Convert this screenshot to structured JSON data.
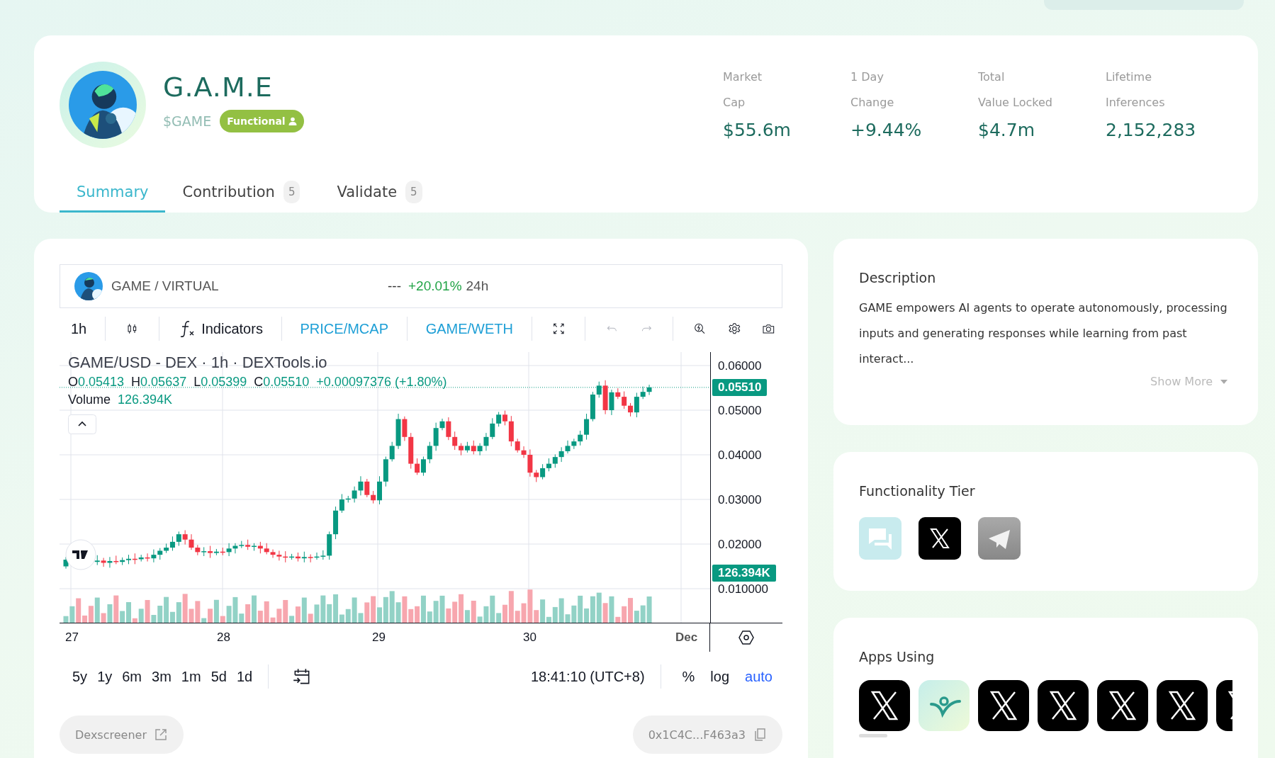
{
  "header": {
    "name": "G.A.M.E",
    "ticker": "$GAME",
    "badge": "Functional",
    "stats": [
      {
        "label": "Market\nCap",
        "value": "$55.6m"
      },
      {
        "label": "1 Day\nChange",
        "value": "+9.44%"
      },
      {
        "label": "Total\nValue Locked",
        "value": "$4.7m"
      },
      {
        "label": "Lifetime\nInferences",
        "value": "2,152,283"
      }
    ]
  },
  "tabs": [
    {
      "label": "Summary",
      "selected": true
    },
    {
      "label": "Contribution",
      "count": "5",
      "selected": false
    },
    {
      "label": "Validate",
      "count": "5",
      "selected": false
    }
  ],
  "chart": {
    "pair": "GAME / VIRTUAL",
    "price": "---",
    "change": "+20.01%",
    "period": "24h",
    "interval": "1h",
    "indicators": "Indicators",
    "modes": [
      "PRICE/MCAP",
      "GAME/WETH"
    ],
    "legend_title": "GAME/USD - DEX · 1h · DEXTools.io",
    "ohlc": [
      {
        "key": "O",
        "value": "0.05413"
      },
      {
        "key": "H",
        "value": "0.05637"
      },
      {
        "key": "L",
        "value": "0.05399"
      },
      {
        "key": "C",
        "value": "0.05510"
      }
    ],
    "legend_change": "+0.00097376 (+1.80%)",
    "volume_label": "Volume",
    "volume": "126.394K",
    "price_ticks": [
      "0.06000",
      "0.05000",
      "0.04000",
      "0.03000",
      "0.02000",
      "0.010000"
    ],
    "last_price": "0.05510",
    "last_volume": "126.394K",
    "dates": [
      "27",
      "28",
      "29",
      "30",
      "Dec"
    ],
    "ranges": [
      "5y",
      "1y",
      "6m",
      "3m",
      "1m",
      "5d",
      "1d"
    ],
    "time": "18:41:10 (UTC+8)",
    "scales": [
      {
        "label": "%",
        "selected": false
      },
      {
        "label": "log",
        "selected": false
      },
      {
        "label": "auto",
        "selected": true
      }
    ]
  },
  "links": {
    "dexscreener": "Dexscreener",
    "address": "0x1C4C...F463a3"
  },
  "description": {
    "title": "Description",
    "text": "GAME empowers AI agents to operate autonomously, processing inputs and generating responses while learning from past interact...",
    "show_more": "Show More"
  },
  "functionality": {
    "title": "Functionality Tier",
    "items": [
      {
        "kind": "chat"
      },
      {
        "kind": "x"
      },
      {
        "kind": "telegram"
      }
    ]
  },
  "apps": {
    "title": "Apps Using",
    "items": [
      {
        "kind": "x"
      },
      {
        "kind": "app"
      },
      {
        "kind": "x"
      },
      {
        "kind": "x"
      },
      {
        "kind": "x"
      },
      {
        "kind": "x"
      },
      {
        "kind": "x"
      }
    ]
  }
}
